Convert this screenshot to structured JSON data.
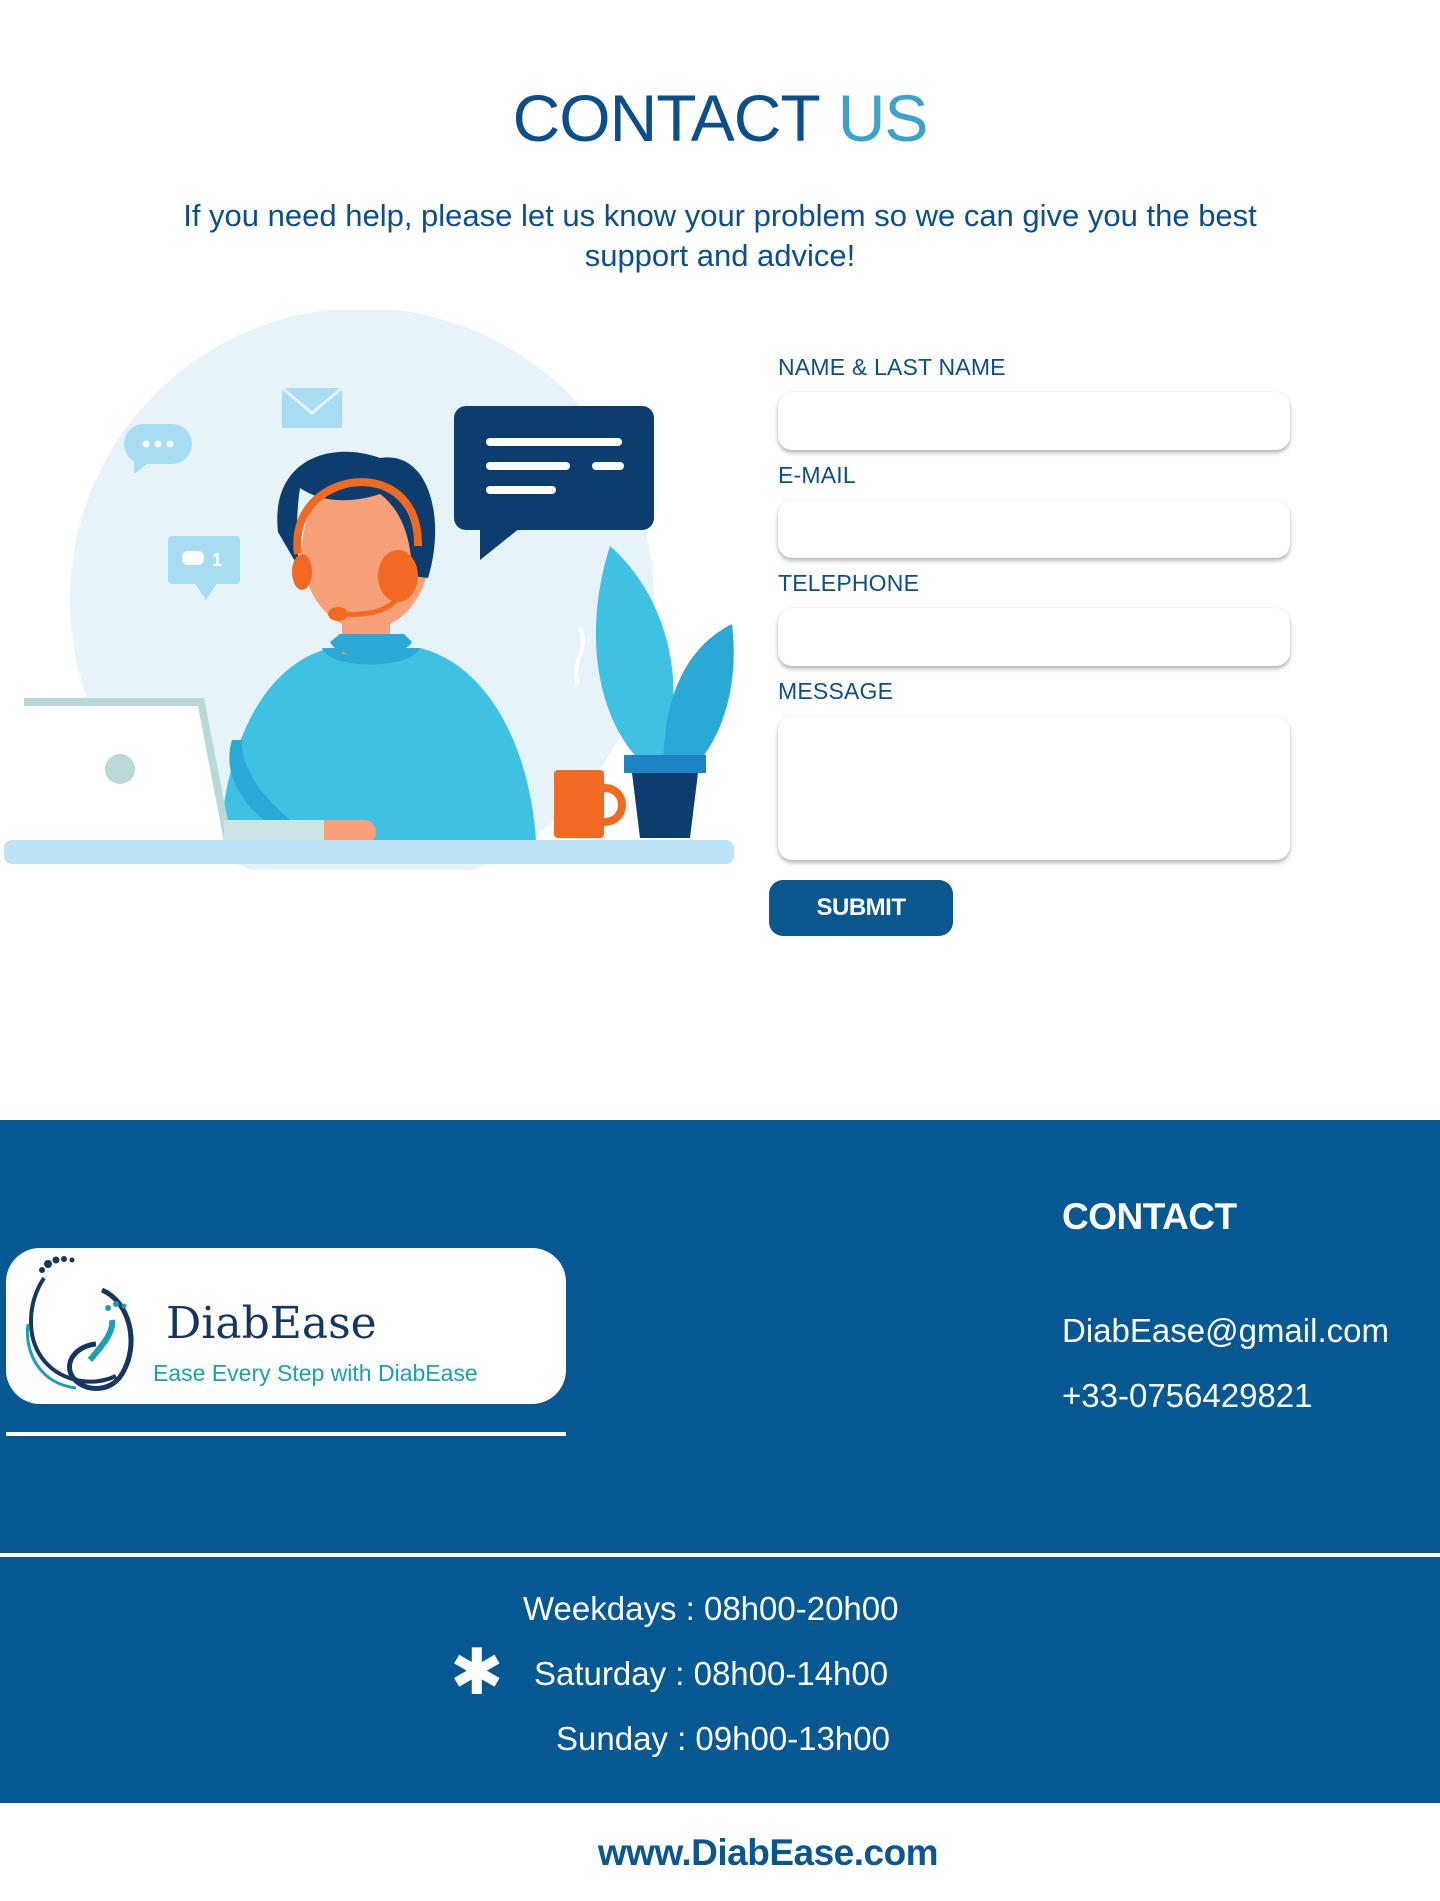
{
  "header": {
    "title_part1": "CONTACT",
    "title_part2": "US",
    "subtitle": "If you need help, please let us know your problem so we can give you the best support and advice!"
  },
  "form": {
    "name_label": "NAME & LAST NAME",
    "email_label": "E-MAIL",
    "phone_label": "TELEPHONE",
    "message_label": "MESSAGE",
    "name_value": "",
    "email_value": "",
    "phone_value": "",
    "message_value": "",
    "submit_label": "SUBMIT"
  },
  "illustration": {
    "badge_count": "1"
  },
  "footer": {
    "logo_name": "DiabEase",
    "logo_tagline": "Ease Every Step with DiabEase",
    "contact_heading": "CONTACT",
    "email": "DiabEase@gmail.com",
    "phone": "+33-0756429821",
    "hours": [
      "Weekdays : 08h00-20h00",
      "Saturday : 08h00-14h00",
      "Sunday : 09h00-13h00"
    ],
    "hours_icon": "asterisk-icon",
    "website": "www.DiabEase.com"
  },
  "colors": {
    "primary": "#0a4f8c",
    "accent": "#3ba3c9",
    "footer_bg": "#065893",
    "illustration_orange": "#f26a21",
    "illustration_cyan": "#3fc1e4"
  }
}
